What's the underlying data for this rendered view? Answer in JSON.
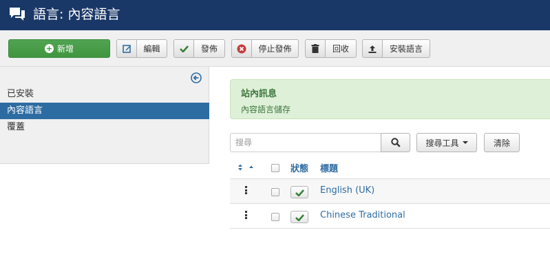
{
  "header": {
    "title": "語言: 內容語言",
    "logo_icon": "chat-bubbles-icon"
  },
  "toolbar": {
    "new_label": "新增",
    "edit_label": "編輯",
    "publish_label": "發佈",
    "unpublish_label": "停止發佈",
    "trash_label": "回收",
    "install_label": "安裝語言"
  },
  "sidebar": {
    "items": [
      {
        "label": "已安裝",
        "active": false
      },
      {
        "label": "內容語言",
        "active": true
      },
      {
        "label": "覆蓋",
        "active": false
      }
    ]
  },
  "message": {
    "heading": "站內訊息",
    "text": "內容語言儲存"
  },
  "filter": {
    "search_placeholder": "搜尋",
    "search_value": "",
    "tools_label": "搜尋工具",
    "clear_label": "清除"
  },
  "table": {
    "columns": {
      "status": "狀態",
      "title": "標題"
    },
    "rows": [
      {
        "title": "English (UK)",
        "published": true
      },
      {
        "title": "Chinese Traditional",
        "published": true
      }
    ]
  },
  "colors": {
    "header_bg": "#1a3867",
    "accent_blue": "#2d6ca2",
    "new_button": "#51a351",
    "alert_bg": "#dff0d8",
    "alert_text": "#3c763d",
    "publish_check": "#378137",
    "unpublish_icon": "#c23c3c"
  }
}
